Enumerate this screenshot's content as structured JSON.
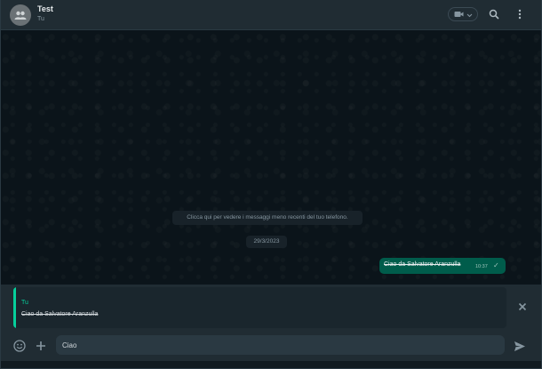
{
  "header": {
    "chat_title": "Test",
    "chat_subtitle": "Tu",
    "icons": [
      "group-avatar-icon",
      "video-call-icon",
      "chevron-down-icon",
      "search-icon",
      "menu-dots-icon"
    ]
  },
  "chat": {
    "system_message": "Clicca qui per vedere i messaggi meno recenti del tuo telefono.",
    "date_label": "29/3/2023",
    "messages": [
      {
        "text": "Ciao da Salvatore Aranzulla",
        "time": "10:37",
        "status": "sent"
      }
    ]
  },
  "reply": {
    "author": "Tu",
    "text": "Ciao da Salvatore Aranzulla"
  },
  "composer": {
    "value": "Ciao",
    "icons": [
      "emoji-icon",
      "plus-icon",
      "send-icon"
    ]
  },
  "colors": {
    "background": "#0b141a",
    "panel": "#202c33",
    "outgoing_bubble": "#005c4b",
    "accent": "#06cf9c",
    "muted_text": "#8696a0"
  }
}
